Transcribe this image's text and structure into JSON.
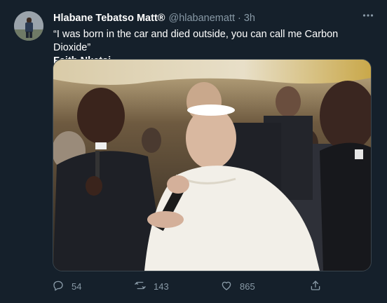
{
  "tweet": {
    "author_name": "Hlabane Tebatso Matt®",
    "handle": "@hlabanematt",
    "separator": "·",
    "time": "3h",
    "more_icon": "more-horizontal-icon",
    "text_line1": "“I was born in the car and died outside, you can call me Carbon Dioxide”",
    "text_line2": "Faith Nketsi"
  },
  "actions": {
    "reply_count": "54",
    "retweet_count": "143",
    "like_count": "865",
    "icons": [
      "reply-icon",
      "retweet-icon",
      "like-icon",
      "share-icon"
    ]
  },
  "colors": {
    "background": "#15202b",
    "secondary_text": "#8899a6",
    "border": "#38444d"
  }
}
